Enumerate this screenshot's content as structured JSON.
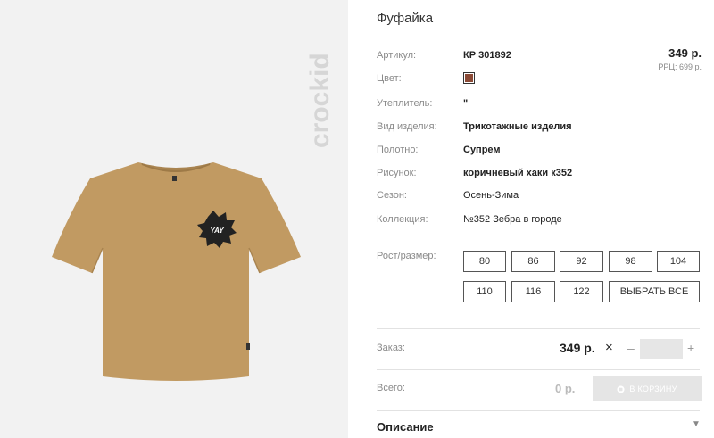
{
  "product": {
    "title": "Фуфайка",
    "price": "349 р.",
    "rrp": "РРЦ: 699 р.",
    "colors": {
      "swatch": "#8b4a36",
      "shirt": "#c19a62"
    }
  },
  "brand": {
    "logo_text": "crockid"
  },
  "details": [
    {
      "label": "Артикул:",
      "value": "КР 301892"
    },
    {
      "label": "Цвет:",
      "value": ""
    },
    {
      "label": "Утеплитель:",
      "value": "\""
    },
    {
      "label": "Вид изделия:",
      "value": "Трикотажные изделия"
    },
    {
      "label": "Полотно:",
      "value": "Супрем"
    },
    {
      "label": "Рисунок:",
      "value": "коричневый хаки к352"
    },
    {
      "label": "Сезон:",
      "value": "Осень-Зима"
    },
    {
      "label": "Коллекция:",
      "value": "№352 Зебра в городе"
    }
  ],
  "sizes": {
    "label": "Рост/размер:",
    "options": [
      "80",
      "86",
      "92",
      "98",
      "104",
      "110",
      "116",
      "122"
    ],
    "select_all": "ВЫБРАТЬ ВСЕ"
  },
  "order": {
    "label": "Заказ:",
    "price": "349 р.",
    "times": "×",
    "minus": "–",
    "plus": "+",
    "quantity": ""
  },
  "total": {
    "label": "Всего:",
    "value": "0 р.",
    "cart_button": "В КОРЗИНУ"
  },
  "description": {
    "title": "Описание",
    "chevron": "▼"
  },
  "badge_text": "YAY"
}
